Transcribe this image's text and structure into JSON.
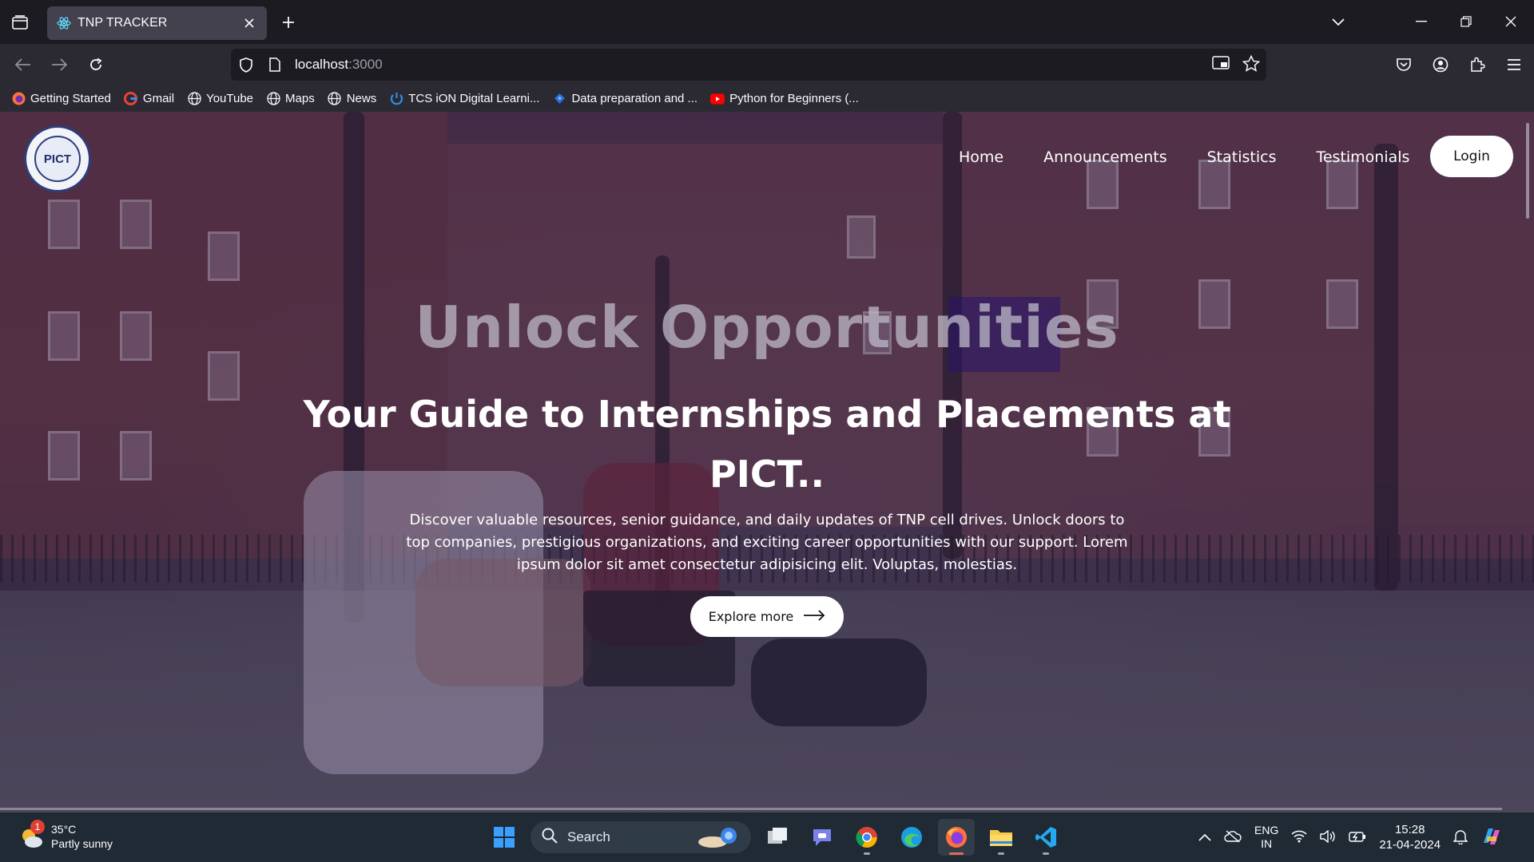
{
  "browser": {
    "tab": {
      "title": "TNP TRACKER"
    },
    "url": {
      "host": "localhost",
      "port": ":3000"
    },
    "bookmarks": [
      {
        "label": "Getting Started",
        "icon": "firefox-icon"
      },
      {
        "label": "Gmail",
        "icon": "google-icon"
      },
      {
        "label": "YouTube",
        "icon": "globe-icon"
      },
      {
        "label": "Maps",
        "icon": "globe-icon"
      },
      {
        "label": "News",
        "icon": "globe-icon"
      },
      {
        "label": "TCS iON Digital Learni...",
        "icon": "tcs-icon"
      },
      {
        "label": "Data preparation and ...",
        "icon": "kaggle-icon"
      },
      {
        "label": "Python for Beginners (...",
        "icon": "youtube-icon"
      }
    ]
  },
  "site": {
    "logo_text": "PICT",
    "nav": [
      "Home",
      "Announcements",
      "Statistics",
      "Testimonials"
    ],
    "login_label": "Login",
    "headline": "Unlock Opportunities",
    "subheadline": "Your Guide to Internships and Placements at PICT..",
    "description": "Discover valuable resources, senior guidance, and daily updates of TNP cell drives. Unlock doors to top companies, prestigious organizations, and exciting career opportunities with our support. Lorem ipsum dolor sit amet consectetur adipisicing elit. Voluptas, molestias.",
    "cta_label": "Explore more"
  },
  "taskbar": {
    "weather": {
      "temp": "35°C",
      "condition": "Partly sunny",
      "badge": "1"
    },
    "search_placeholder": "Search",
    "lang": [
      "ENG",
      "IN"
    ],
    "time": "15:28",
    "date": "21-04-2024"
  },
  "colors": {
    "chrome_dark": "#1c1b22",
    "chrome_toolbar": "#2b2a33",
    "taskbar": "#1f2a35",
    "accent_firefox": "#e46b5b"
  }
}
